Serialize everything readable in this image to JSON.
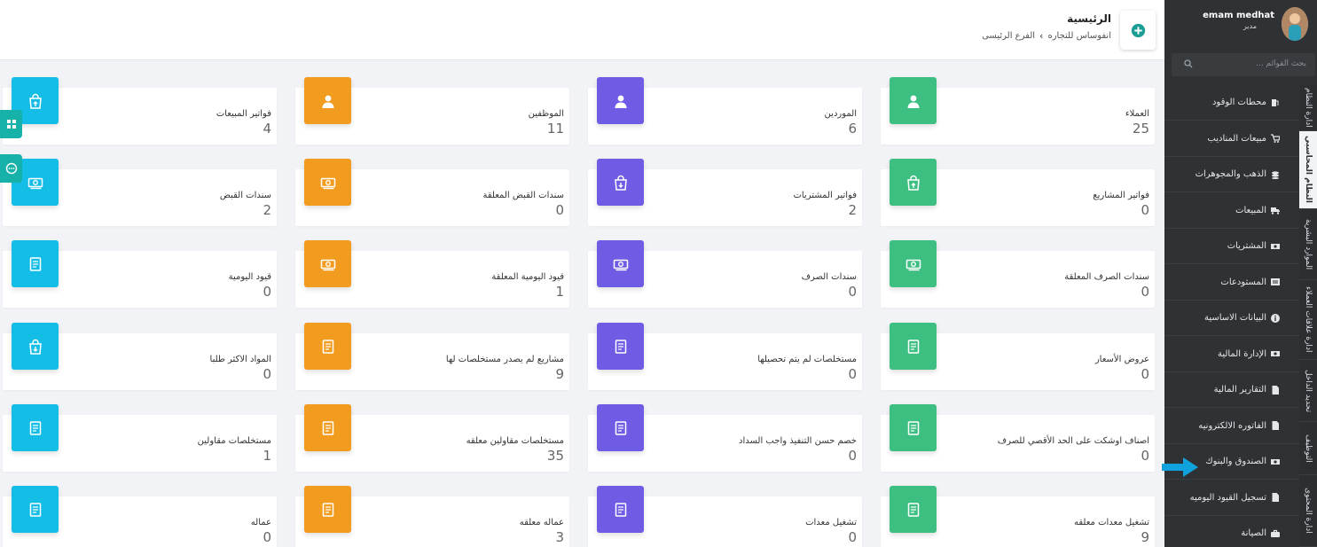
{
  "header": {
    "title": "الرئيسية",
    "breadcrumbs": [
      "انفوساس للتجاره",
      "الفرع الرئيسى"
    ]
  },
  "cards": [
    {
      "label": "العملاء",
      "value": "25",
      "color": "#3ebf82",
      "icon": "user-icon"
    },
    {
      "label": "الموردين",
      "value": "6",
      "color": "#6e5ce5",
      "icon": "user-icon"
    },
    {
      "label": "الموظفين",
      "value": "11",
      "color": "#f29c1f",
      "icon": "user-icon"
    },
    {
      "label": "فواتير المبيعات",
      "value": "4",
      "color": "#13bde6",
      "icon": "shopping-bag-up-icon"
    },
    {
      "label": "فواتير المشاريع",
      "value": "0",
      "color": "#3ebf82",
      "icon": "shopping-bag-up-icon"
    },
    {
      "label": "فواتير المشتريات",
      "value": "2",
      "color": "#6e5ce5",
      "icon": "shopping-bag-down-icon"
    },
    {
      "label": "سندات القبض المعلقة",
      "value": "0",
      "color": "#f29c1f",
      "icon": "money-icon"
    },
    {
      "label": "سندات القبض",
      "value": "2",
      "color": "#13bde6",
      "icon": "money-icon"
    },
    {
      "label": "سندات الصرف المعلقة",
      "value": "0",
      "color": "#3ebf82",
      "icon": "money-icon"
    },
    {
      "label": "سندات الصرف",
      "value": "0",
      "color": "#6e5ce5",
      "icon": "money-icon"
    },
    {
      "label": "قيود اليومية المعلقة",
      "value": "1",
      "color": "#f29c1f",
      "icon": "money-icon"
    },
    {
      "label": "قيود اليومية",
      "value": "0",
      "color": "#13bde6",
      "icon": "document-icon"
    },
    {
      "label": "عروض الأسعار",
      "value": "0",
      "color": "#3ebf82",
      "icon": "document-icon"
    },
    {
      "label": "مستخلصات لم يتم تحصيلها",
      "value": "0",
      "color": "#6e5ce5",
      "icon": "document-icon"
    },
    {
      "label": "مشاريع لم يصدر مستخلصات لها",
      "value": "9",
      "color": "#f29c1f",
      "icon": "document-icon"
    },
    {
      "label": "المواد الاكثر طلبا",
      "value": "0",
      "color": "#13bde6",
      "icon": "shopping-bag-down-icon"
    },
    {
      "label": "اصناف اوشكت على الحد الأقصي للصرف",
      "value": "0",
      "color": "#3ebf82",
      "icon": "document-icon"
    },
    {
      "label": "خصم حسن التنفيذ واجب السداد",
      "value": "0",
      "color": "#6e5ce5",
      "icon": "document-icon"
    },
    {
      "label": "مستخلصات مقاولين معلقه",
      "value": "35",
      "color": "#f29c1f",
      "icon": "document-icon"
    },
    {
      "label": "مستخلصات مقاولين",
      "value": "1",
      "color": "#13bde6",
      "icon": "document-icon"
    },
    {
      "label": "تشغيل معدات معلقه",
      "value": "9",
      "color": "#3ebf82",
      "icon": "document-icon"
    },
    {
      "label": "تشغيل معدات",
      "value": "0",
      "color": "#6e5ce5",
      "icon": "document-icon"
    },
    {
      "label": "عماله معلقه",
      "value": "3",
      "color": "#f29c1f",
      "icon": "document-icon"
    },
    {
      "label": "عماله",
      "value": "0",
      "color": "#13bde6",
      "icon": "document-icon"
    }
  ],
  "sidebar": {
    "user_name": "emam medhat",
    "user_role": "مدير",
    "search_placeholder": "بحث القوائم ...",
    "items": [
      {
        "label": "محطات الوقود",
        "icon": "fuel-icon"
      },
      {
        "label": "مبيعات المناديب",
        "icon": "cart-icon"
      },
      {
        "label": "الذهب والمجوهرات",
        "icon": "coins-icon"
      },
      {
        "label": "المبيعات",
        "icon": "truck-icon"
      },
      {
        "label": "المشتريات",
        "icon": "money-icon"
      },
      {
        "label": "المستودعات",
        "icon": "warehouse-icon"
      },
      {
        "label": "البيانات الاساسية",
        "icon": "info-icon"
      },
      {
        "label": "الإدارة المالية",
        "icon": "money-icon"
      },
      {
        "label": "التقارير المالية",
        "icon": "file-icon"
      },
      {
        "label": "الفاتوره الالكترونيه",
        "icon": "file-icon"
      },
      {
        "label": "الصندوق والبنوك",
        "icon": "money-icon"
      },
      {
        "label": "تسجيل القيود اليوميه",
        "icon": "file-icon"
      },
      {
        "label": "الصيانة",
        "icon": "briefcase-icon"
      }
    ],
    "vertical_tabs": [
      "ادارة النظام",
      "النظام المحاسبي",
      "الموارد البشرية",
      "ادارة علاقات العملاء",
      "تحديد الداخل",
      "التوظيف",
      "ادارة المحتوى"
    ]
  }
}
